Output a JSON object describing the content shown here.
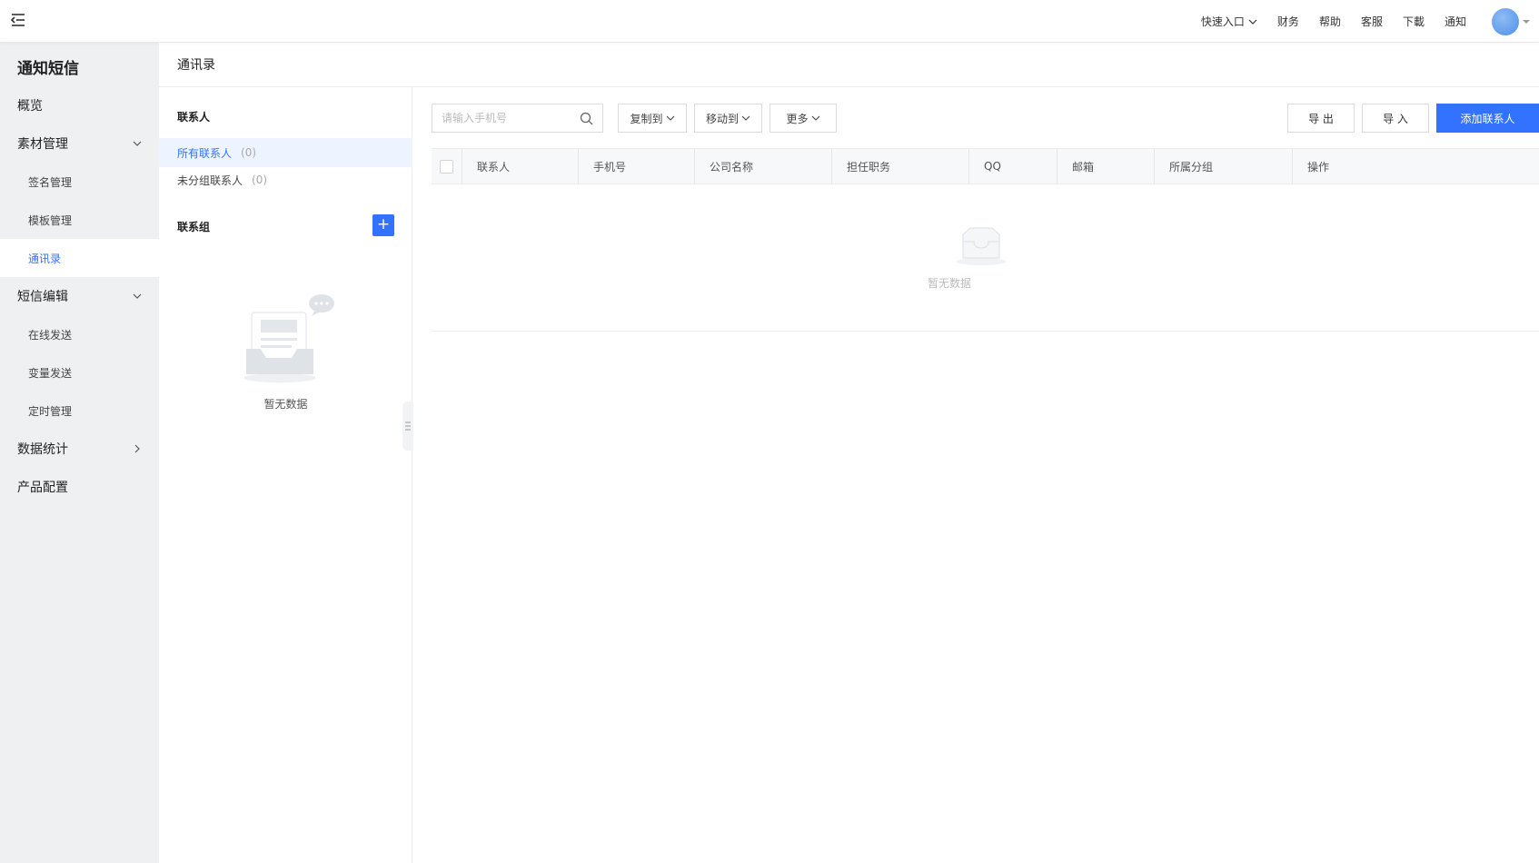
{
  "topbar": {
    "quick_entry": "快速入口",
    "finance": "财务",
    "help": "帮助",
    "service": "客服",
    "download": "下載",
    "notice": "通知"
  },
  "sidebar": {
    "title": "通知短信",
    "overview": "概览",
    "material": "素材管理",
    "signature": "签名管理",
    "template": "模板管理",
    "contacts": "通讯录",
    "sms_edit": "短信编辑",
    "online_send": "在线发送",
    "var_send": "变量发送",
    "timer": "定时管理",
    "stats": "数据统计",
    "config": "产品配置"
  },
  "page": {
    "title": "通讯录"
  },
  "left_panel": {
    "contacts_title": "联系人",
    "all_contacts": "所有联系人",
    "all_count": "(0)",
    "ungrouped": "未分组联系人",
    "ungrouped_count": "(0)",
    "groups_title": "联系组",
    "add": "+",
    "empty": "暂无数据"
  },
  "toolbar": {
    "search_placeholder": "请输入手机号",
    "copy_to": "复制到",
    "move_to": "移动到",
    "more": "更多",
    "export": "导 出",
    "import": "导 入",
    "add_contact": "添加联系人"
  },
  "table": {
    "headers": [
      "联系人",
      "手机号",
      "公司名称",
      "担任职务",
      "QQ",
      "邮箱",
      "所属分组",
      "操作"
    ],
    "empty": "暂无数据"
  },
  "colors": {
    "accent": "#3372ff"
  }
}
